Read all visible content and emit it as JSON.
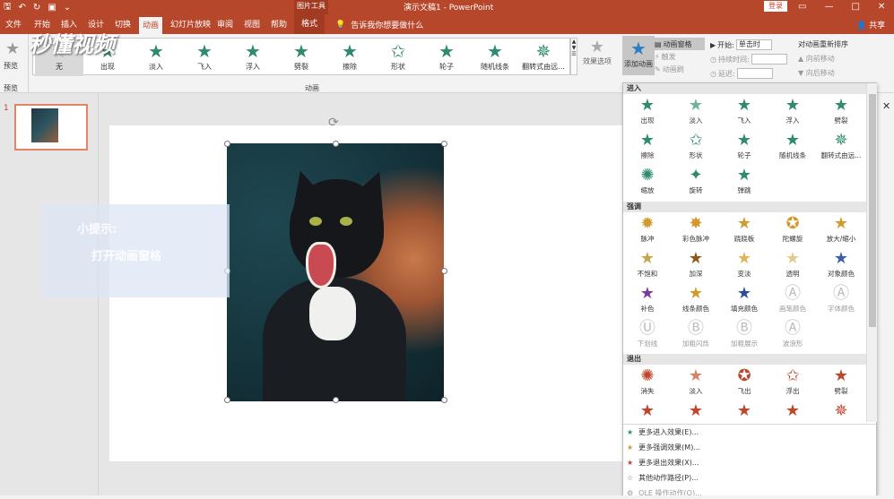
{
  "titlebar": {
    "picture_tools": "图片工具",
    "doc_title": "演示文稿1 - PowerPoint",
    "login": "登录"
  },
  "tabs": [
    "文件",
    "开始",
    "插入",
    "设计",
    "切换",
    "动画",
    "幻灯片放映",
    "审阅",
    "视图",
    "帮助",
    "格式"
  ],
  "tellme": "告诉我你想要做什么",
  "share": "共享",
  "ribbon": {
    "preview_label": "预览",
    "preview_group": "预览",
    "effects": [
      "无",
      "出现",
      "淡入",
      "飞入",
      "浮入",
      "劈裂",
      "擦除",
      "形状",
      "轮子",
      "随机线条",
      "翻转式由远..."
    ],
    "effect_options": "效果选项",
    "group_label": "动画",
    "add_animation": "添加动画",
    "anim_pane": "动画窗格",
    "trigger": "触发",
    "anim_painter": "动画刷",
    "start_label": "开始:",
    "start_value": "单击时",
    "duration_label": "持续时间:",
    "delay_label": "延迟:",
    "reorder_title": "对动画重新排序",
    "move_earlier": "向前移动",
    "move_later": "向后移动"
  },
  "slide_pane": {
    "number": "1"
  },
  "canvas": {
    "tip_line1": "小提示:",
    "tip_line2": "打开动画窗格",
    "watermark": "秒懂视频"
  },
  "dropdown": {
    "entrance_title": "进入",
    "entrance": [
      "出现",
      "淡入",
      "飞入",
      "浮入",
      "劈裂",
      "擦除",
      "形状",
      "轮子",
      "随机线条",
      "翻转式由远...",
      "缩放",
      "旋转",
      "弹跳"
    ],
    "emphasis_title": "强调",
    "emphasis": [
      "脉冲",
      "彩色脉冲",
      "跷跷板",
      "陀螺旋",
      "放大/缩小",
      "不饱和",
      "加深",
      "变淡",
      "透明",
      "对象颜色",
      "补色",
      "线条颜色",
      "填充颜色",
      "画笔颜色",
      "字体颜色",
      "下划线",
      "加粗闪烁",
      "加粗展示",
      "波浪形"
    ],
    "exit_title": "退出",
    "exit": [
      "消失",
      "淡入",
      "飞出",
      "浮出",
      "劈裂"
    ],
    "more": [
      "更多进入效果(E)...",
      "更多强调效果(M)...",
      "更多退出效果(X)...",
      "其他动作路径(P)...",
      "OLE 操作动作(O)..."
    ]
  },
  "colors": {
    "brand": "#b7472a",
    "entrance": "#2e8b6f",
    "emphasis": "#d19a2c",
    "exit": "#c0462a"
  }
}
